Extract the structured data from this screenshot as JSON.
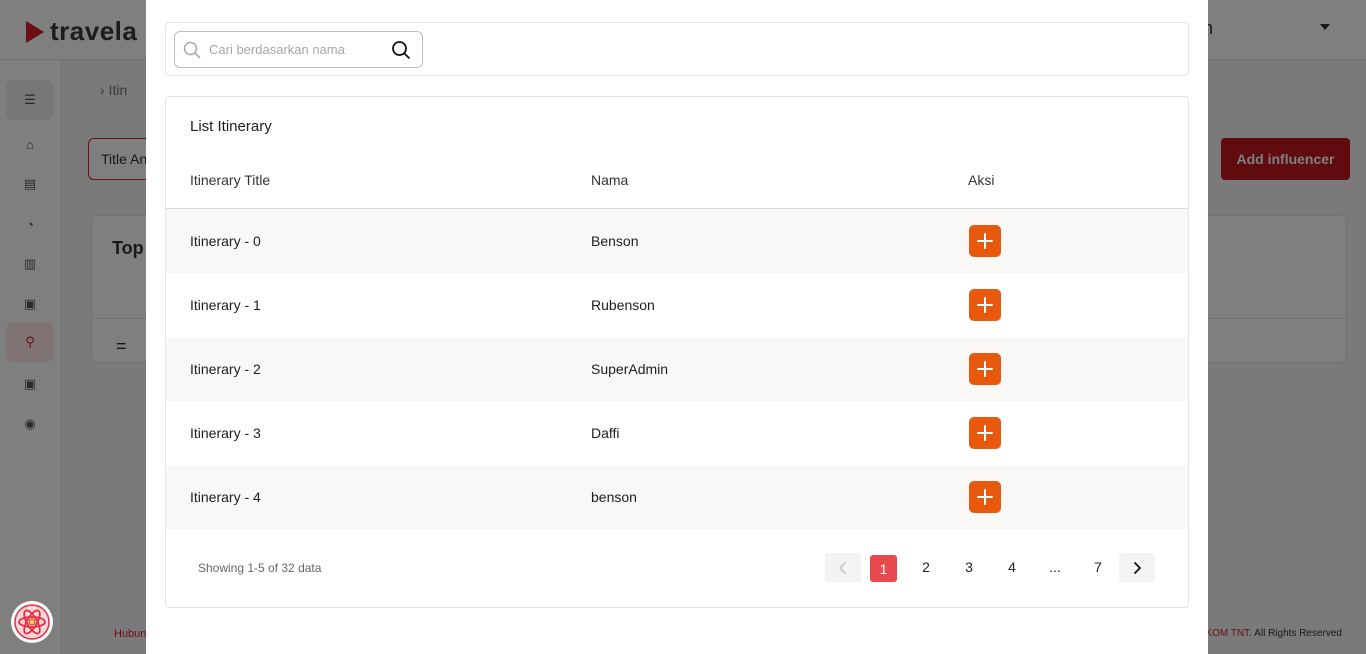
{
  "background": {
    "logo_text": "travela",
    "user_initial": "n",
    "breadcrumb": "›   Itin",
    "title_input_value": "Title An",
    "add_button": "Add influencer",
    "card_title": "Top",
    "footer_left": "Hubun",
    "footer_right_brand": "KOM TNT",
    "footer_right_rest": ". All Rights Reserved",
    "sidebar_icons": [
      "menu-icon",
      "home-icon",
      "document-icon",
      "chart-pie-icon",
      "bar-chart-icon",
      "badge-icon",
      "location-pin-icon",
      "badge-icon",
      "user-icon"
    ]
  },
  "search": {
    "placeholder": "Cari berdasarkan nama",
    "value": ""
  },
  "list": {
    "title": "List Itinerary",
    "columns": [
      "Itinerary Title",
      "Nama",
      "Aksi"
    ],
    "rows": [
      {
        "title": "Itinerary - 0",
        "name": "Benson"
      },
      {
        "title": "Itinerary - 1",
        "name": "Rubenson"
      },
      {
        "title": "Itinerary - 2",
        "name": "SuperAdmin"
      },
      {
        "title": "Itinerary - 3",
        "name": "Daffi"
      },
      {
        "title": "Itinerary - 4",
        "name": "benson"
      }
    ],
    "action_icon": "plus-icon"
  },
  "pagination": {
    "summary": "Showing 1-5 of 32 data",
    "pages": [
      "1",
      "2",
      "3",
      "4",
      "...",
      "7"
    ],
    "current": "1",
    "prev_icon": "chevron-left-icon",
    "next_icon": "chevron-right-icon"
  },
  "colors": {
    "brand_red": "#d61f26",
    "action_orange": "#e8590c",
    "active_page": "#e9484d"
  }
}
